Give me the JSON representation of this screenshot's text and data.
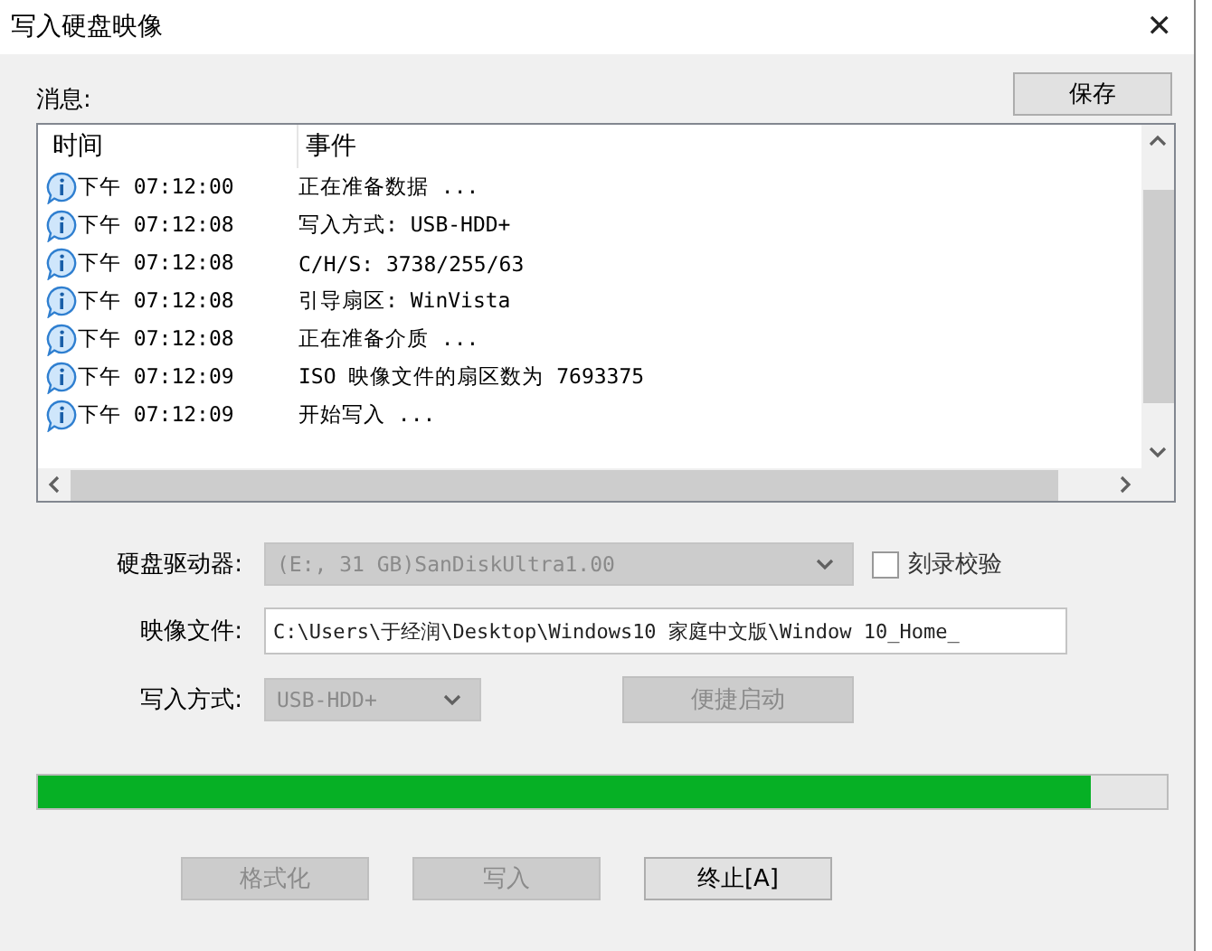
{
  "window": {
    "title": "写入硬盘映像",
    "close": "✕"
  },
  "messages": {
    "label": "消息:",
    "save_button": "保存",
    "columns": [
      "时间",
      "事件"
    ],
    "rows": [
      {
        "time": "下午 07:12:00",
        "event": "正在准备数据 ..."
      },
      {
        "time": "下午 07:12:08",
        "event": "写入方式: USB-HDD+"
      },
      {
        "time": "下午 07:12:08",
        "event": "C/H/S: 3738/255/63"
      },
      {
        "time": "下午 07:12:08",
        "event": "引导扇区: WinVista"
      },
      {
        "time": "下午 07:12:08",
        "event": "正在准备介质 ..."
      },
      {
        "time": "下午 07:12:09",
        "event": "ISO 映像文件的扇区数为 7693375"
      },
      {
        "time": "下午 07:12:09",
        "event": "开始写入 ..."
      }
    ]
  },
  "drive": {
    "label": "硬盘驱动器:",
    "value": "(E:, 31 GB)SanDiskUltra1.00",
    "disabled": true
  },
  "verify": {
    "label": "刻录校验",
    "checked": false
  },
  "image_file": {
    "label": "映像文件:",
    "value": "C:\\Users\\于经润\\Desktop\\Windows10 家庭中文版\\Window 10_Home_"
  },
  "write_mode": {
    "label": "写入方式:",
    "value": "USB-HDD+",
    "disabled": true
  },
  "quick_boot": {
    "label": "便捷启动",
    "disabled": true
  },
  "progress": {
    "level": 0.933
  },
  "buttons": [
    {
      "label": "格式化",
      "disabled": true
    },
    {
      "label": "写入",
      "disabled": true
    },
    {
      "label": "终止[A]",
      "disabled": false
    }
  ]
}
